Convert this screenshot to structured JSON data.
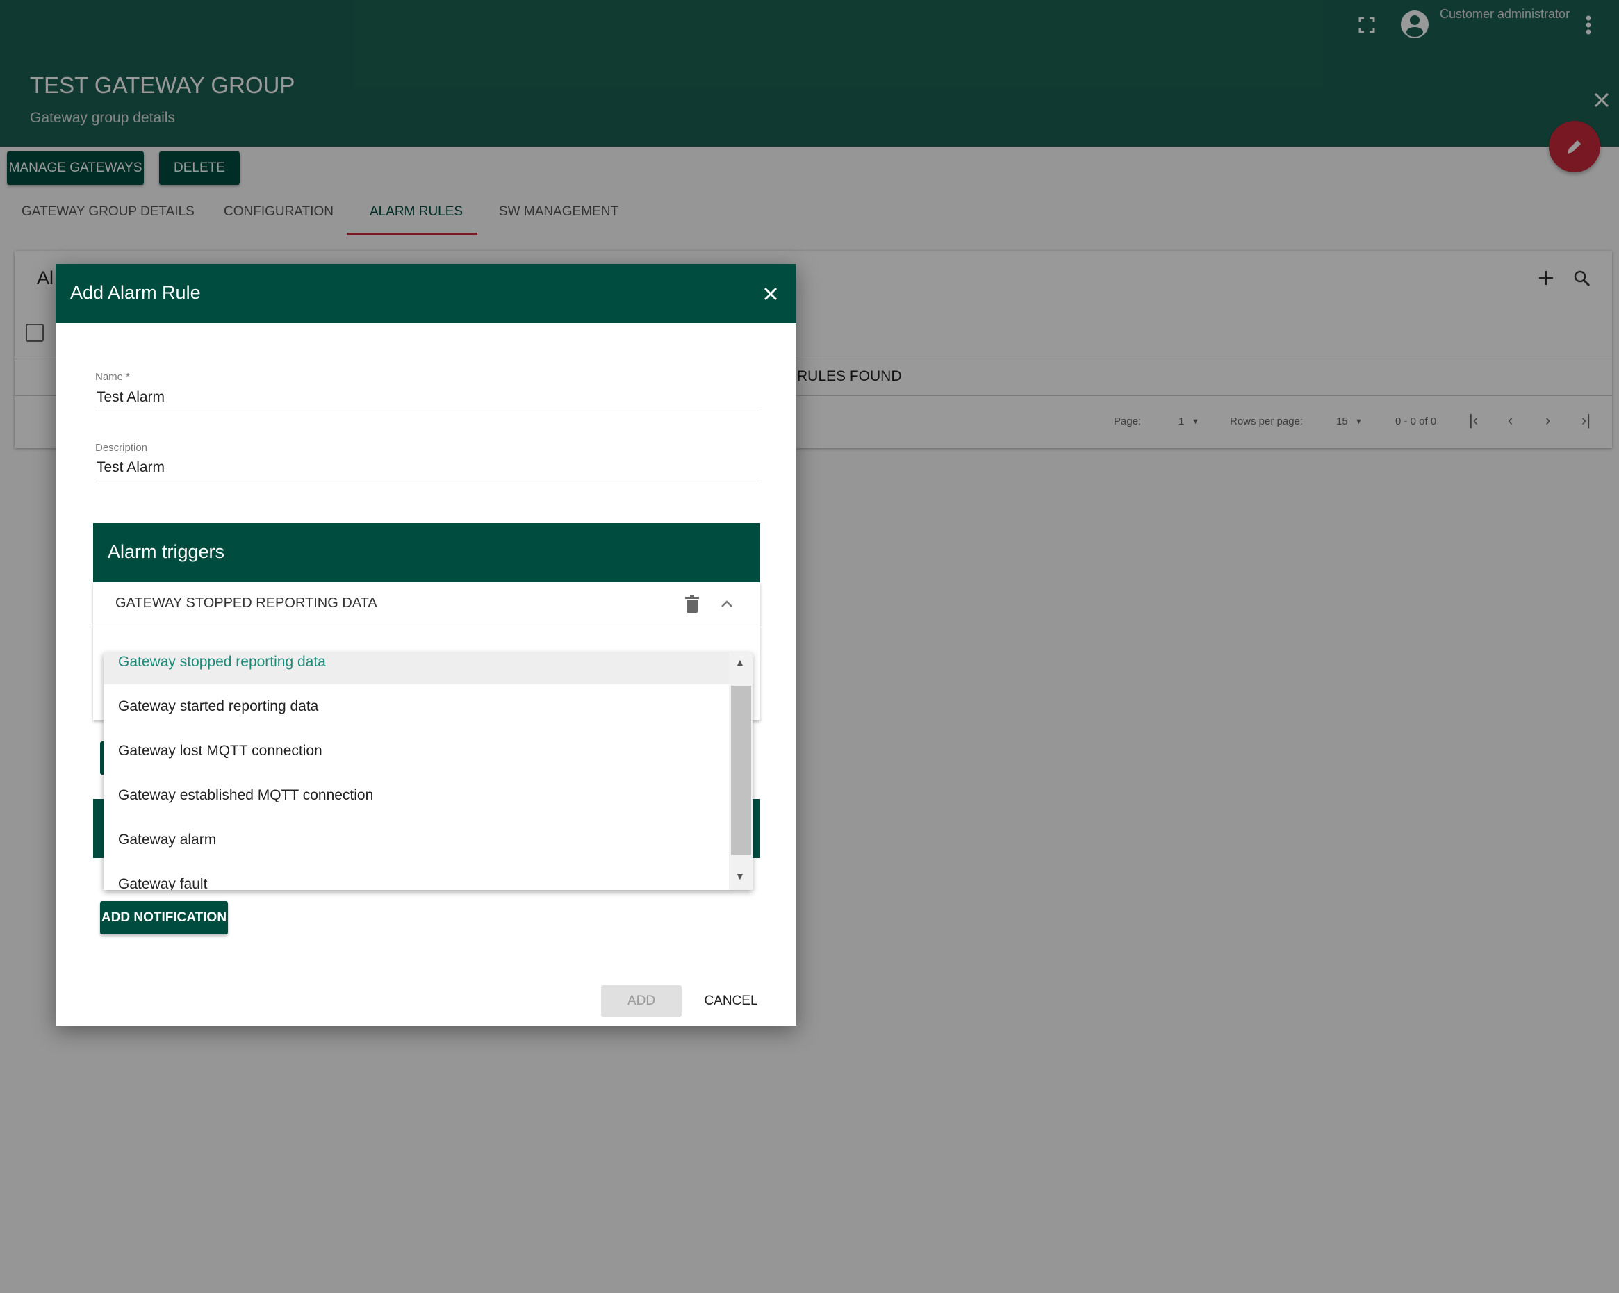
{
  "header": {
    "title": "TEST GATEWAY GROUP",
    "subtitle": "Gateway group details",
    "user": "Customer administrator"
  },
  "actions": {
    "manage": "MANAGE GATEWAYS",
    "delete": "DELETE"
  },
  "tabs": [
    {
      "label": "GATEWAY GROUP DETAILS"
    },
    {
      "label": "CONFIGURATION"
    },
    {
      "label": "ALARM RULES",
      "active": true
    },
    {
      "label": "SW MANAGEMENT"
    }
  ],
  "card": {
    "title_partial": "Al",
    "empty": "RULES FOUND",
    "page_label": "Page:",
    "page": "1",
    "rows_label": "Rows per page:",
    "rows": "15",
    "range": "0 - 0 of 0"
  },
  "dialog": {
    "title": "Add Alarm Rule",
    "name_label": "Name *",
    "name_value": "Test Alarm",
    "desc_label": "Description",
    "desc_value": "Test Alarm",
    "triggers_title": "Alarm triggers",
    "trigger_name": "GATEWAY STOPPED REPORTING DATA",
    "options": [
      "Gateway stopped reporting data",
      "Gateway started reporting data",
      "Gateway lost MQTT connection",
      "Gateway established MQTT connection",
      "Gateway alarm",
      "Gateway fault"
    ],
    "add_notification": "ADD NOTIFICATION",
    "add": "ADD",
    "cancel": "CANCEL"
  },
  "colors": {
    "primary": "#004d40",
    "accent": "#c62839",
    "selected_option": "#1d8a78"
  }
}
